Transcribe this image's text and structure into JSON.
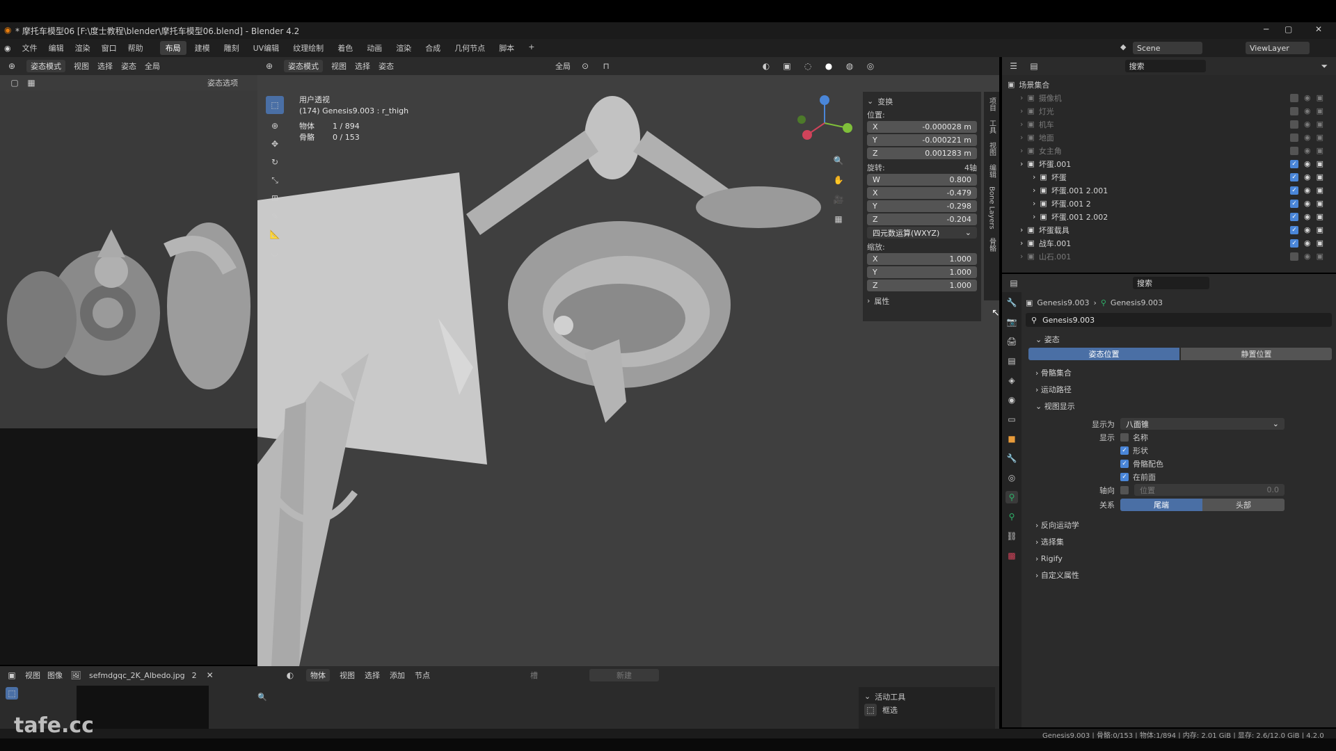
{
  "title_bar": {
    "text": "* 摩托车模型06 [F:\\度士教程\\blender\\摩托车模型06.blend] - Blender 4.2"
  },
  "menu": [
    "文件",
    "编辑",
    "渲染",
    "窗口",
    "帮助"
  ],
  "workspaces": [
    "布局",
    "建模",
    "雕刻",
    "UV编辑",
    "纹理绘制",
    "着色",
    "动画",
    "渲染",
    "合成",
    "几何节点",
    "脚本"
  ],
  "scene": {
    "label": "Scene",
    "viewlayer": "ViewLayer"
  },
  "left_header": {
    "mode": "姿态模式",
    "view": "视图",
    "select": "选择",
    "pose": "姿态",
    "global": "全局",
    "pose_options": "姿态选项"
  },
  "vp_header": {
    "mode": "姿态模式",
    "view": "视图",
    "select": "选择",
    "pose": "姿态",
    "global": "全局",
    "pose_options": "姿态选项"
  },
  "vp_info": {
    "persp": "用户透视",
    "active": "(174) Genesis9.003 : r_thigh",
    "obj_label": "物体",
    "obj_val": "1 / 894",
    "bone_label": "骨骼",
    "bone_val": "0 / 153"
  },
  "npanel": {
    "transform": "变换",
    "location": "位置:",
    "loc": [
      {
        "axis": "X",
        "val": "-0.000028 m"
      },
      {
        "axis": "Y",
        "val": "-0.000221 m"
      },
      {
        "axis": "Z",
        "val": "0.001283 m"
      }
    ],
    "rotation": "旋转:",
    "rot_mode_short": "4轴",
    "rot": [
      {
        "axis": "W",
        "val": "0.800"
      },
      {
        "axis": "X",
        "val": "-0.479"
      },
      {
        "axis": "Y",
        "val": "-0.298"
      },
      {
        "axis": "Z",
        "val": "-0.204"
      }
    ],
    "rot_mode": "四元数运算(WXYZ)",
    "scale": "缩放:",
    "scl": [
      {
        "axis": "X",
        "val": "1.000"
      },
      {
        "axis": "Y",
        "val": "1.000"
      },
      {
        "axis": "Z",
        "val": "1.000"
      }
    ],
    "props": "属性",
    "tabs": [
      "项目",
      "工具",
      "视图",
      "编辑",
      "Bone Layers",
      "骨骼"
    ]
  },
  "outliner": {
    "search": "搜索",
    "root": "场景集合",
    "rows": [
      {
        "name": "摄像机",
        "indent": 1,
        "dim": true,
        "checked": false
      },
      {
        "name": "灯光",
        "indent": 1,
        "dim": true,
        "checked": false
      },
      {
        "name": "机车",
        "indent": 1,
        "dim": true,
        "checked": false
      },
      {
        "name": "地面",
        "indent": 1,
        "dim": true,
        "checked": false
      },
      {
        "name": "女主角",
        "indent": 1,
        "dim": true,
        "checked": false
      },
      {
        "name": "坏蛋.001",
        "indent": 1,
        "dim": false,
        "checked": true
      },
      {
        "name": "坏蛋",
        "indent": 2,
        "dim": false,
        "checked": true
      },
      {
        "name": "坏蛋.001 2.001",
        "indent": 2,
        "dim": false,
        "checked": true
      },
      {
        "name": "坏蛋.001 2",
        "indent": 2,
        "dim": false,
        "checked": true
      },
      {
        "name": "坏蛋.001 2.002",
        "indent": 2,
        "dim": false,
        "checked": true
      },
      {
        "name": "坏蛋载具",
        "indent": 1,
        "dim": false,
        "checked": true
      },
      {
        "name": "战车.001",
        "indent": 1,
        "dim": false,
        "checked": true
      },
      {
        "name": "山石.001",
        "indent": 1,
        "dim": true,
        "checked": false
      }
    ]
  },
  "props": {
    "search": "搜索",
    "crumb1": "Genesis9.003",
    "crumb2": "Genesis9.003",
    "datablock": "Genesis9.003",
    "pose_section": "姿态",
    "pose_pos": "姿态位置",
    "rest_pos": "静置位置",
    "bone_collections": "骨骼集合",
    "motion_paths": "运动路径",
    "viewport_display": "视图显示",
    "display_as_label": "显示为",
    "display_as": "八面锥",
    "show_label": "显示",
    "show_items": [
      {
        "label": "名称",
        "on": false
      },
      {
        "label": "形状",
        "on": true
      },
      {
        "label": "骨骼配色",
        "on": true
      },
      {
        "label": "在前面",
        "on": true
      }
    ],
    "axes_label": "轴向",
    "axes_pos": "位置",
    "axes_val": "0.0",
    "relation_label": "关系",
    "tail": "尾端",
    "head": "头部",
    "ik": "反向运动学",
    "selection_sets": "选择集",
    "rigify": "Rigify",
    "custom_props": "自定义属性"
  },
  "image_editor": {
    "view": "视图",
    "image": "图像",
    "filename": "sefmdgqc_2K_Albedo.jpg",
    "users": "2"
  },
  "node_editor": {
    "object": "物体",
    "view": "视图",
    "select": "选择",
    "add": "添加",
    "node": "节点",
    "slot": "槽",
    "new": "新建"
  },
  "active_tool": {
    "title": "活动工具",
    "tool": "框选"
  },
  "status": {
    "text": "Genesis9.003 | 骨骼:0/153 | 物体:1/894 | 内存: 2.01 GiB | 显存: 2.6/12.0 GiB | 4.2.0"
  },
  "watermark": "tafe.cc",
  "colors": {
    "accent": "#4a86d8",
    "bone_green": "#2fb36a",
    "selected_orange": "#e89b3a"
  }
}
